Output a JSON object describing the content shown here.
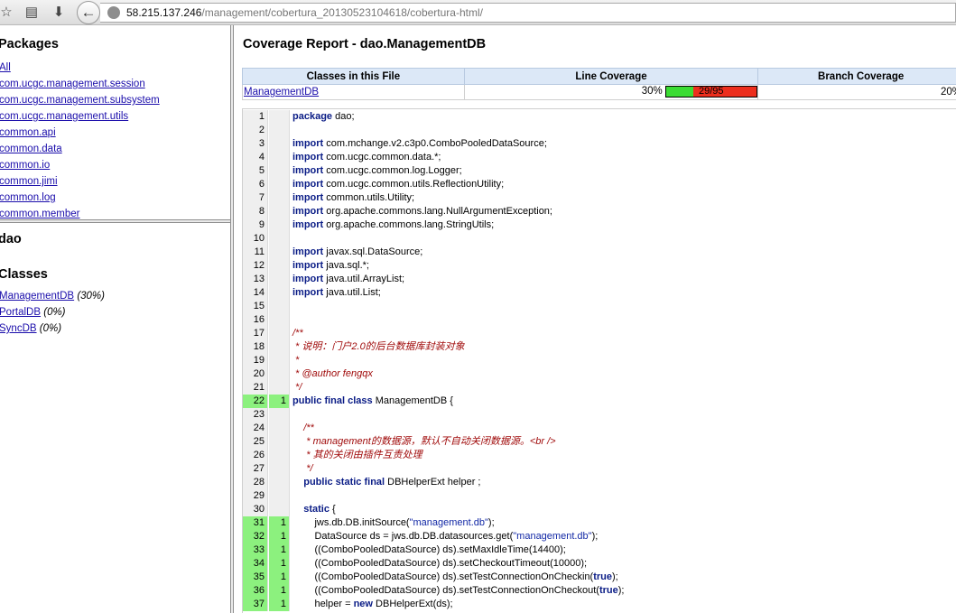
{
  "browser": {
    "url_host": "58.215.137.246",
    "url_path": "/management/cobertura_20130523104618/cobertura-html/",
    "icons": [
      "star-icon",
      "reader-icon",
      "download-icon",
      "back-arrow-icon",
      "globe-icon"
    ]
  },
  "packages": {
    "heading": "Packages",
    "items": [
      "All",
      "com.ucgc.management.session",
      "com.ucgc.management.subsystem",
      "com.ucgc.management.utils",
      "common.api",
      "common.data",
      "common.io",
      "common.jimi",
      "common.log",
      "common.member"
    ]
  },
  "classes_frame": {
    "package_name": "dao",
    "heading": "Classes",
    "items": [
      {
        "name": "ManagementDB",
        "pct": "(30%)"
      },
      {
        "name": "PortalDB",
        "pct": "(0%)"
      },
      {
        "name": "SyncDB",
        "pct": "(0%)"
      }
    ]
  },
  "report": {
    "title": "Coverage Report - dao.ManagementDB",
    "table": {
      "headers": [
        "Classes in this File",
        "Line Coverage",
        "Branch Coverage"
      ],
      "row": {
        "class_name": "ManagementDB",
        "line_pct": "30%",
        "line_fraction": "29/95",
        "line_ratio": 0.305,
        "branch_pct": "20%"
      }
    }
  },
  "colors": {
    "covered": "#8cf17e",
    "bar_green": "#3bdc33",
    "bar_red": "#ec2e1d",
    "table_header": "#dce8f7"
  },
  "source": [
    {
      "n": "1",
      "hits": "",
      "code": [
        [
          "kw",
          "package"
        ],
        [
          "t",
          " dao;"
        ]
      ]
    },
    {
      "n": "2",
      "hits": "",
      "code": []
    },
    {
      "n": "3",
      "hits": "",
      "code": [
        [
          "kw",
          "import"
        ],
        [
          "t",
          " com.mchange.v2.c3p0.ComboPooledDataSource;"
        ]
      ]
    },
    {
      "n": "4",
      "hits": "",
      "code": [
        [
          "kw",
          "import"
        ],
        [
          "t",
          " com.ucgc.common.data.*;"
        ]
      ]
    },
    {
      "n": "5",
      "hits": "",
      "code": [
        [
          "kw",
          "import"
        ],
        [
          "t",
          " com.ucgc.common.log.Logger;"
        ]
      ]
    },
    {
      "n": "6",
      "hits": "",
      "code": [
        [
          "kw",
          "import"
        ],
        [
          "t",
          " com.ucgc.common.utils.ReflectionUtility;"
        ]
      ]
    },
    {
      "n": "7",
      "hits": "",
      "code": [
        [
          "kw",
          "import"
        ],
        [
          "t",
          " common.utils.Utility;"
        ]
      ]
    },
    {
      "n": "8",
      "hits": "",
      "code": [
        [
          "kw",
          "import"
        ],
        [
          "t",
          " org.apache.commons.lang.NullArgumentException;"
        ]
      ]
    },
    {
      "n": "9",
      "hits": "",
      "code": [
        [
          "kw",
          "import"
        ],
        [
          "t",
          " org.apache.commons.lang.StringUtils;"
        ]
      ]
    },
    {
      "n": "10",
      "hits": "",
      "code": []
    },
    {
      "n": "11",
      "hits": "",
      "code": [
        [
          "kw",
          "import"
        ],
        [
          "t",
          " javax.sql.DataSource;"
        ]
      ]
    },
    {
      "n": "12",
      "hits": "",
      "code": [
        [
          "kw",
          "import"
        ],
        [
          "t",
          " java.sql.*;"
        ]
      ]
    },
    {
      "n": "13",
      "hits": "",
      "code": [
        [
          "kw",
          "import"
        ],
        [
          "t",
          " java.util.ArrayList;"
        ]
      ]
    },
    {
      "n": "14",
      "hits": "",
      "code": [
        [
          "kw",
          "import"
        ],
        [
          "t",
          " java.util.List;"
        ]
      ]
    },
    {
      "n": "15",
      "hits": "",
      "code": []
    },
    {
      "n": "16",
      "hits": "",
      "code": []
    },
    {
      "n": "17",
      "hits": "",
      "code": [
        [
          "cm",
          "/**"
        ]
      ]
    },
    {
      "n": "18",
      "hits": "",
      "code": [
        [
          "cm",
          " * 说明：门户2.0的后台数据库封装对象"
        ]
      ]
    },
    {
      "n": "19",
      "hits": "",
      "code": [
        [
          "cm",
          " *"
        ]
      ]
    },
    {
      "n": "20",
      "hits": "",
      "code": [
        [
          "cm",
          " * @author fengqx"
        ]
      ]
    },
    {
      "n": "21",
      "hits": "",
      "code": [
        [
          "cm",
          " */"
        ]
      ]
    },
    {
      "n": "22",
      "hits": "1",
      "code": [
        [
          "kw",
          "public final class"
        ],
        [
          "t",
          " ManagementDB {"
        ]
      ]
    },
    {
      "n": "23",
      "hits": "",
      "code": []
    },
    {
      "n": "24",
      "hits": "",
      "code": [
        [
          "cm",
          "    /**"
        ]
      ]
    },
    {
      "n": "25",
      "hits": "",
      "code": [
        [
          "cm",
          "     * management的数据源，默认不自动关闭数据源。<br />"
        ]
      ]
    },
    {
      "n": "26",
      "hits": "",
      "code": [
        [
          "cm",
          "     * 其的关闭由插件互责处理"
        ]
      ]
    },
    {
      "n": "27",
      "hits": "",
      "code": [
        [
          "cm",
          "     */"
        ]
      ]
    },
    {
      "n": "28",
      "hits": "",
      "code": [
        [
          "t",
          "    "
        ],
        [
          "kw",
          "public static final"
        ],
        [
          "t",
          " DBHelperExt helper ;"
        ]
      ]
    },
    {
      "n": "29",
      "hits": "",
      "code": []
    },
    {
      "n": "30",
      "hits": "",
      "code": [
        [
          "t",
          "    "
        ],
        [
          "kw",
          "static"
        ],
        [
          "t",
          " {"
        ]
      ]
    },
    {
      "n": "31",
      "hits": "1",
      "code": [
        [
          "t",
          "        jws.db.DB.initSource("
        ],
        [
          "str",
          "\"management.db\""
        ],
        [
          "t",
          ");"
        ]
      ]
    },
    {
      "n": "32",
      "hits": "1",
      "code": [
        [
          "t",
          "        DataSource ds = jws.db.DB.datasources.get("
        ],
        [
          "str",
          "\"management.db\""
        ],
        [
          "t",
          ");"
        ]
      ]
    },
    {
      "n": "33",
      "hits": "1",
      "code": [
        [
          "t",
          "        ((ComboPooledDataSource) ds).setMaxIdleTime(14400);"
        ]
      ]
    },
    {
      "n": "34",
      "hits": "1",
      "code": [
        [
          "t",
          "        ((ComboPooledDataSource) ds).setCheckoutTimeout(10000);"
        ]
      ]
    },
    {
      "n": "35",
      "hits": "1",
      "code": [
        [
          "t",
          "        ((ComboPooledDataSource) ds).setTestConnectionOnCheckin("
        ],
        [
          "kw",
          "true"
        ],
        [
          "t",
          ");"
        ]
      ]
    },
    {
      "n": "36",
      "hits": "1",
      "code": [
        [
          "t",
          "        ((ComboPooledDataSource) ds).setTestConnectionOnCheckout("
        ],
        [
          "kw",
          "true"
        ],
        [
          "t",
          ");"
        ]
      ]
    },
    {
      "n": "37",
      "hits": "1",
      "code": [
        [
          "t",
          "        helper = "
        ],
        [
          "kw",
          "new"
        ],
        [
          "t",
          " DBHelperExt(ds);"
        ]
      ]
    }
  ]
}
